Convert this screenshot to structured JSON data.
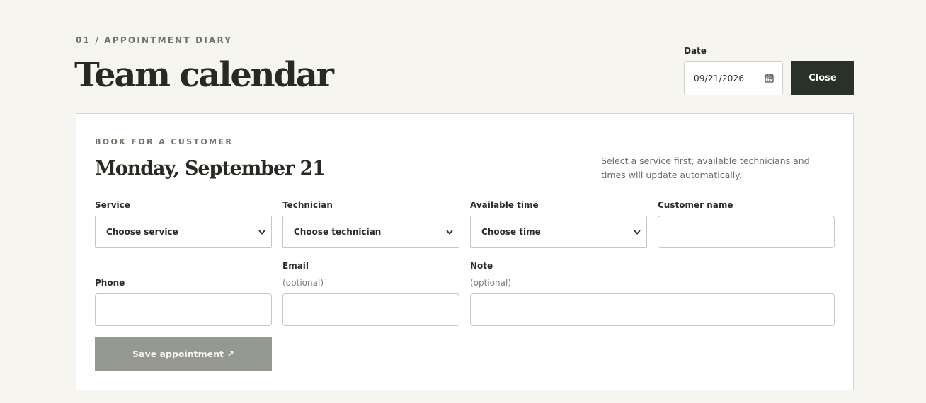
{
  "header": {
    "eyebrow": "01 / APPOINTMENT DIARY",
    "title": "Team calendar",
    "date_label": "Date",
    "date_value": "09/21/2026",
    "date_icon": "calendar-icon",
    "close_label": "Close"
  },
  "booking": {
    "eyebrow": "BOOK FOR A CUSTOMER",
    "title": "Monday, September 21",
    "hint": "Select a service first; available technicians and times will update automatically.",
    "fields": {
      "service": {
        "label": "Service",
        "value": "Choose service"
      },
      "technician": {
        "label": "Technician",
        "value": "Choose technician"
      },
      "time": {
        "label": "Available time",
        "value": "Choose time"
      },
      "customer_name": {
        "label": "Customer name",
        "value": ""
      },
      "phone": {
        "label": "Phone",
        "value": ""
      },
      "email": {
        "label": "Email",
        "sublabel": "(optional)",
        "value": ""
      },
      "note": {
        "label": "Note",
        "sublabel": "(optional)",
        "value": ""
      }
    },
    "save_label": "Save appointment ↗"
  },
  "colors": {
    "background": "#f6f5ef",
    "panel": "#ffffff",
    "primary_button": "#2a3127",
    "disabled_button": "#959891",
    "eyebrow": "#6e7766"
  }
}
